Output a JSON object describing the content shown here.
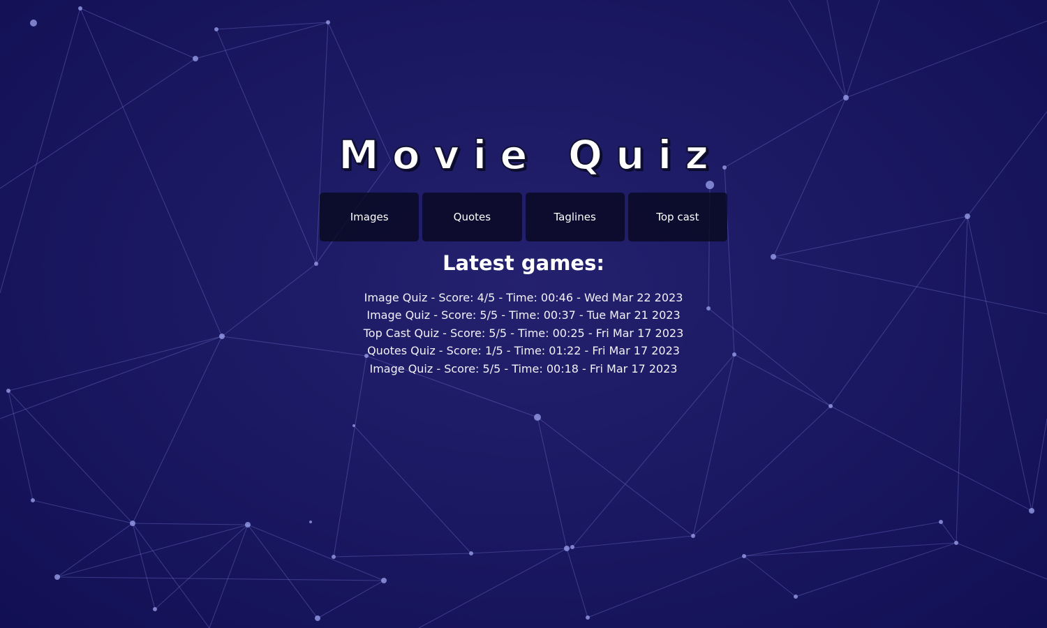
{
  "title": "Movie Quiz",
  "nav": [
    {
      "label": "Images"
    },
    {
      "label": "Quotes"
    },
    {
      "label": "Taglines"
    },
    {
      "label": "Top cast"
    }
  ],
  "latest_games": {
    "heading": "Latest games:",
    "items": [
      "Image Quiz - Score: 4/5 - Time: 00:46 - Wed Mar 22 2023",
      "Image Quiz - Score: 5/5 - Time: 00:37 - Tue Mar 21 2023",
      "Top Cast Quiz - Score: 5/5 - Time: 00:25 - Fri Mar 17 2023",
      "Quotes Quiz - Score: 1/5 - Time: 01:22 - Fri Mar 17 2023",
      "Image Quiz - Score: 5/5 - Time: 00:18 - Fri Mar 17 2023"
    ]
  },
  "colors": {
    "background": "#1b1962",
    "network_lines": "#7a7fd6",
    "button_bg": "#0a0a24",
    "text": "#ffffff"
  }
}
